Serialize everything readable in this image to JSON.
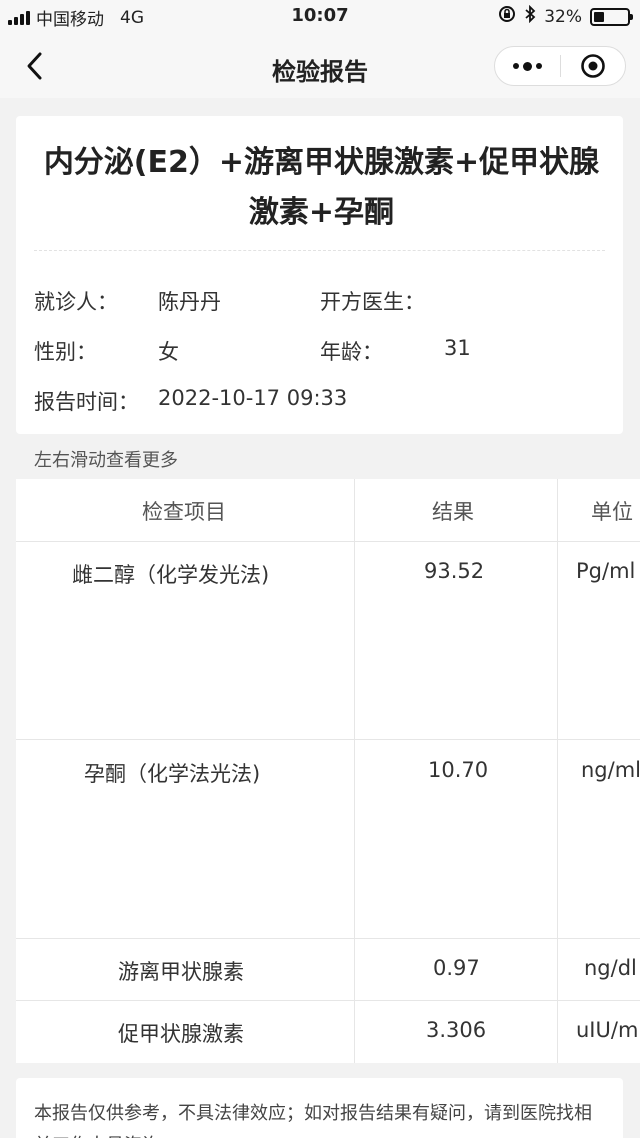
{
  "status": {
    "carrier": "中国移动",
    "network": "4G",
    "time": "10:07",
    "battery_text": "32%",
    "battery_level": 0.32
  },
  "nav": {
    "title": "检验报告",
    "back_icon": "chevron-left-icon",
    "more_icon": "more-dots-icon",
    "close_icon": "target-icon"
  },
  "report": {
    "title": "内分泌(E2）+游离甲状腺激素+促甲状腺激素+孕酮",
    "patient_label": "就诊人：",
    "patient": "陈丹丹",
    "doctor_label": "开方医生：",
    "doctor": "",
    "gender_label": "性别：",
    "gender": "女",
    "age_label": "年龄：",
    "age": "31",
    "time_label": "报告时间：",
    "time": "2022-10-17 09:33"
  },
  "hint": "左右滑动查看更多",
  "table": {
    "headers": [
      "检查项目",
      "结果",
      "单位"
    ],
    "rows": [
      {
        "item": "雌二醇（化学发光法)",
        "result": "93.52",
        "unit": "Pg/ml"
      },
      {
        "item": "孕酮（化学法光法)",
        "result": "10.70",
        "unit": "ng/ml"
      },
      {
        "item": "游离甲状腺素",
        "result": "0.97",
        "unit": "ng/dl"
      },
      {
        "item": "促甲状腺激素",
        "result": "3.306",
        "unit": "uIU/ml"
      }
    ]
  },
  "disclaimer": "本报告仅供参考，不具法律效应；如对报告结果有疑问，请到医院找相关工作人员咨询。"
}
